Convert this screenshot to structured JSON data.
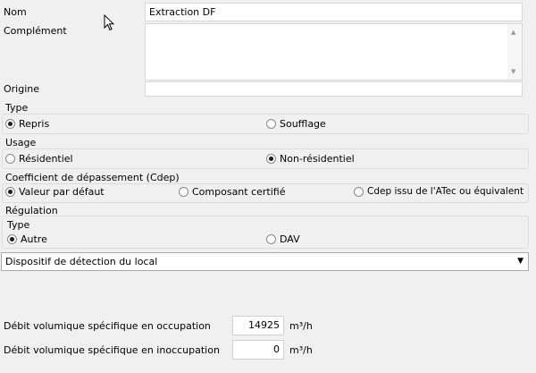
{
  "fields": {
    "nom_label": "Nom",
    "nom_value": "Extraction DF",
    "complement_label": "Complément",
    "complement_value": "",
    "origine_label": "Origine",
    "origine_value": ""
  },
  "type_group": {
    "title": "Type",
    "options": [
      "Repris",
      "Soufflage"
    ],
    "selected": "Repris"
  },
  "usage_group": {
    "title": "Usage",
    "options": [
      "Résidentiel",
      "Non-résidentiel"
    ],
    "selected": "Non-résidentiel"
  },
  "cdep_group": {
    "title": "Coefficient de dépassement (Cdep)",
    "options": [
      "Valeur par défaut",
      "Composant certifié",
      "Cdep issu de l'ATec ou équivalent"
    ],
    "selected": "Valeur par défaut"
  },
  "regulation_group": {
    "title": "Régulation",
    "type_title": "Type",
    "options": [
      "Autre",
      "DAV"
    ],
    "selected": "Autre",
    "dropdown_value": "Dispositif de détection du local"
  },
  "debits": {
    "occupation_label": "Débit volumique spécifique en occupation",
    "occupation_value": "14925",
    "occupation_unit": "m³/h",
    "inoccupation_label": "Débit volumique spécifique en inoccupation",
    "inoccupation_value": "0",
    "inoccupation_unit": "m³/h"
  },
  "icons": {
    "dropdown_arrow": "▼",
    "scroll_up": "▲",
    "scroll_down": "▼",
    "cursor": "mouse-pointer-icon"
  }
}
